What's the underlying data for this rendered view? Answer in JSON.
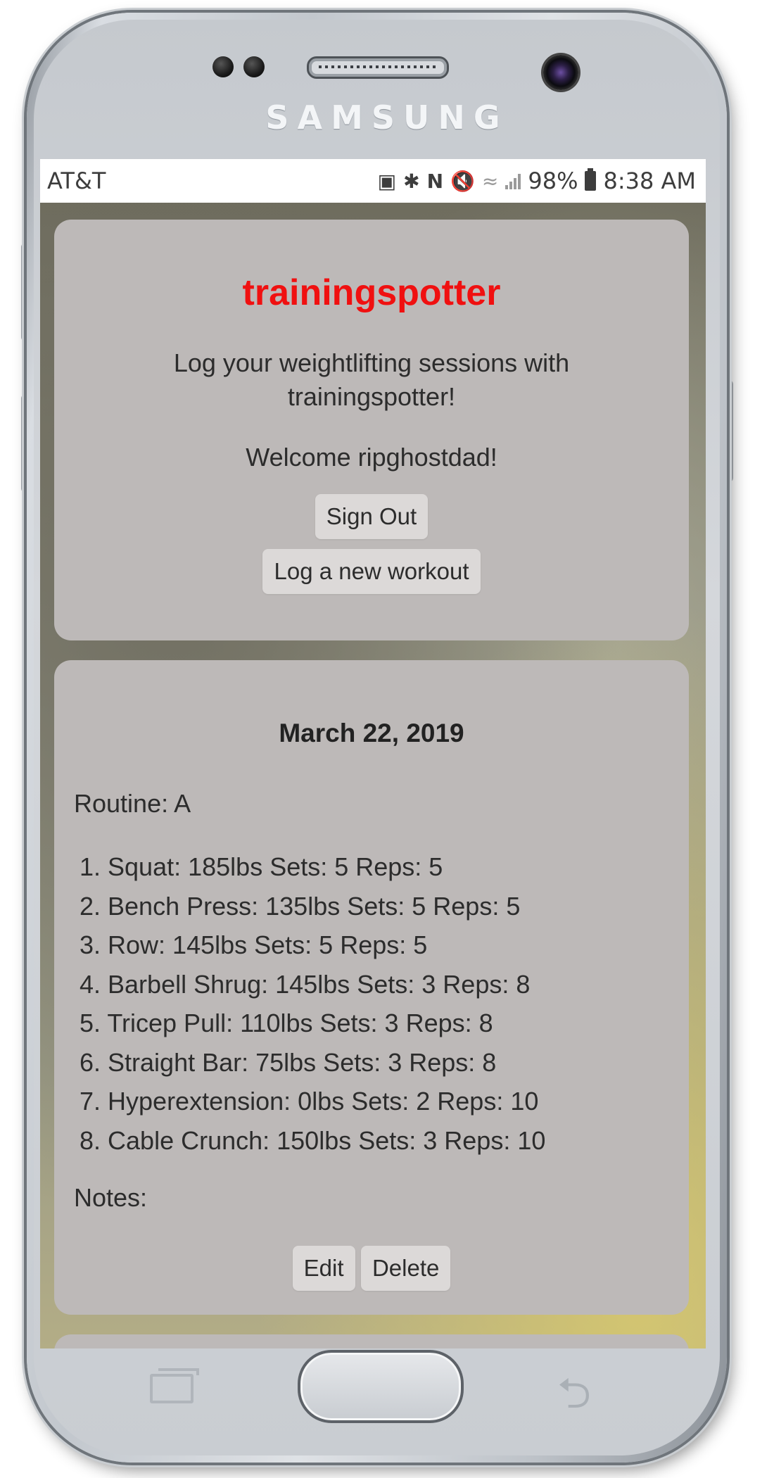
{
  "device": {
    "brand": "SAMSUNG"
  },
  "status_bar": {
    "carrier": "AT&T",
    "battery": "98%",
    "time": "8:38 AM"
  },
  "header_card": {
    "title": "trainingspotter",
    "tagline": "Log your weightlifting sessions with trainingspotter!",
    "welcome": "Welcome ripghostdad!",
    "sign_out_label": "Sign Out",
    "log_workout_label": "Log a new workout"
  },
  "workout": {
    "date": "March 22, 2019",
    "routine": "Routine: A",
    "exercises": [
      "1. Squat: 185lbs Sets: 5 Reps: 5",
      "2. Bench Press: 135lbs Sets: 5 Reps: 5",
      "3. Row: 145lbs Sets: 5 Reps: 5",
      "4. Barbell Shrug: 145lbs Sets: 3 Reps: 8",
      "5. Tricep Pull: 110lbs Sets: 3 Reps: 8",
      "6. Straight Bar: 75lbs Sets: 3 Reps: 8",
      "7. Hyperextension: 0lbs Sets: 2 Reps: 10",
      "8. Cable Crunch: 150lbs Sets: 3 Reps: 10"
    ],
    "notes_label": "Notes:",
    "edit_label": "Edit",
    "delete_label": "Delete"
  },
  "colors": {
    "app_title": "#f01010",
    "card_bg": "#bdb9b8",
    "button_bg": "#dcd9d8"
  }
}
